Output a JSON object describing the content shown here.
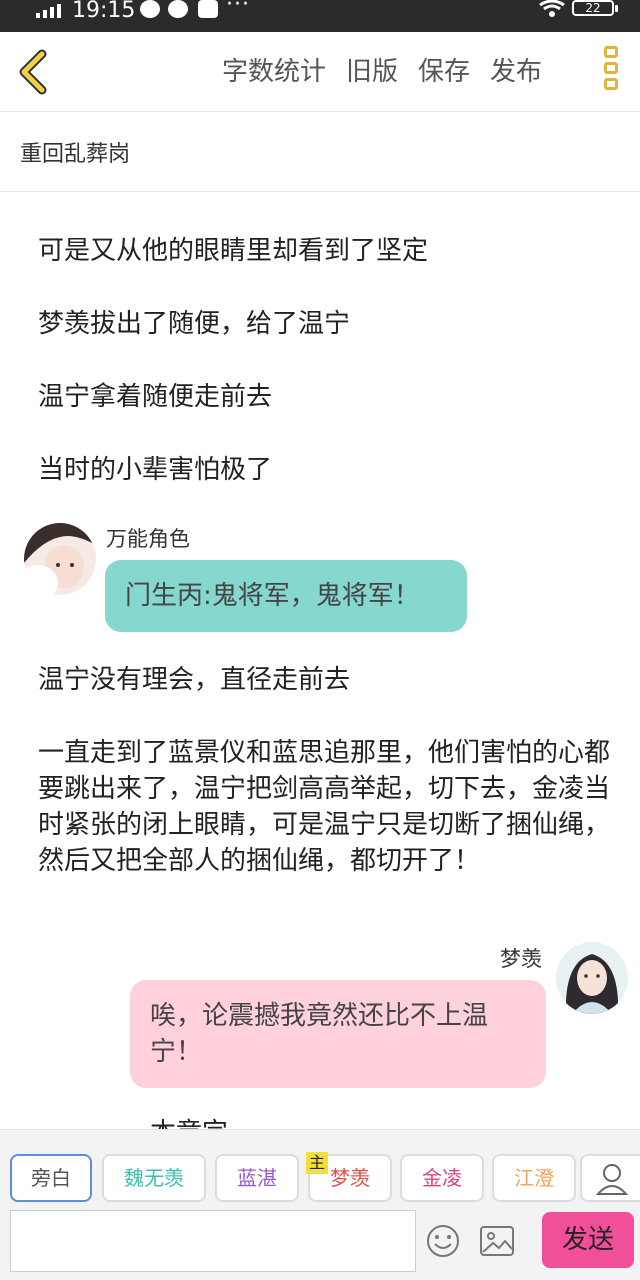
{
  "status_bar": {
    "time": "19:15",
    "battery": "22",
    "more": "···"
  },
  "nav": {
    "actions": [
      "字数统计",
      "旧版",
      "保存",
      "发布"
    ]
  },
  "chapter": {
    "title": "重回乱葬岗"
  },
  "content": {
    "paragraphs": [
      "可是又从他的眼睛里却看到了坚定",
      "梦羡拔出了随便，给了温宁",
      "温宁拿着随便走前去",
      "当时的小辈害怕极了",
      "温宁没有理会，直径走前去",
      "一直走到了蓝景仪和蓝思追那里，他们害怕的心都要跳出来了，温宁把剑高高举起，切下去，金凌当时紧张的闭上眼睛，可是温宁只是切断了捆仙绳，然后又把全部人的捆仙绳，都切开了！"
    ],
    "messages": [
      {
        "speaker": "万能角色",
        "text": "门生丙:鬼将军，鬼将军！",
        "color": "#86d8cf"
      },
      {
        "speaker": "梦羡",
        "text": "唉，论震撼我竟然还比不上温宁！",
        "color": "#ffd1dc"
      }
    ],
    "cut_off_text": "本章完"
  },
  "characters": [
    {
      "label": "旁白",
      "color": "#555555"
    },
    {
      "label": "魏无羡",
      "color": "#3cbfae"
    },
    {
      "label": "蓝湛",
      "color": "#9a58c7"
    },
    {
      "label": "梦羡",
      "color": "#e0504a",
      "badge": "主"
    },
    {
      "label": "金凌",
      "color": "#d9427f"
    },
    {
      "label": "江澄",
      "color": "#f1a35f"
    }
  ],
  "composer": {
    "input_value": "",
    "send_label": "发送"
  }
}
